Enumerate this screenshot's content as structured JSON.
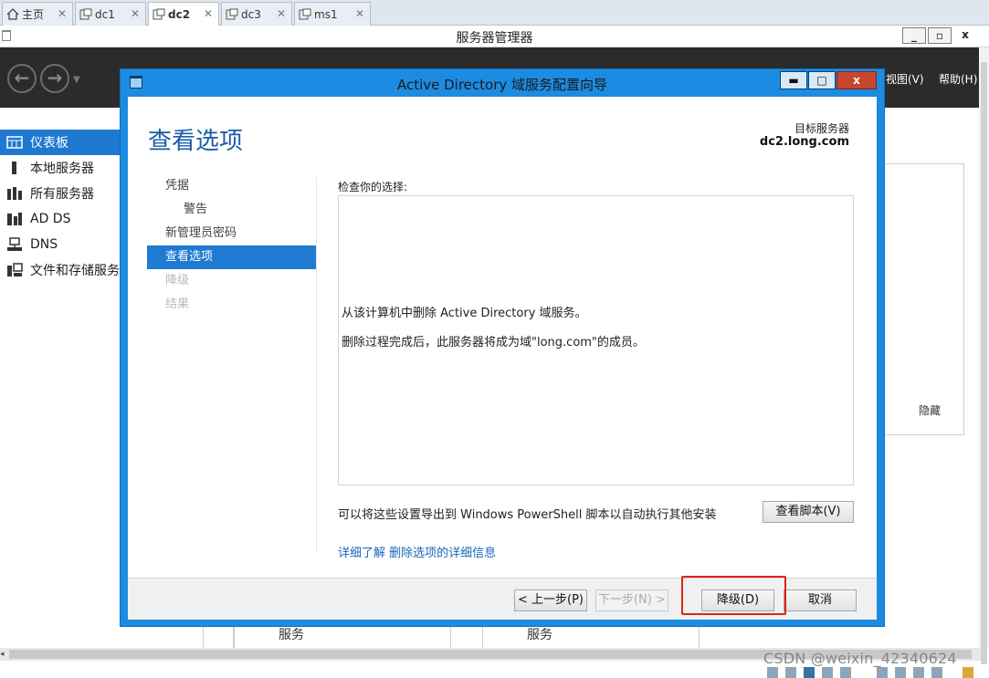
{
  "vm_tabs": [
    {
      "label": "主页",
      "close": "✕"
    },
    {
      "label": "dc1",
      "close": "✕"
    },
    {
      "label": "dc2",
      "close": "✕"
    },
    {
      "label": "dc3",
      "close": "✕"
    },
    {
      "label": "ms1",
      "close": "✕"
    }
  ],
  "server_manager": {
    "title": "服务器管理器",
    "window_controls": {
      "minimize": "_",
      "restore": "▫",
      "close": "x"
    },
    "menus": {
      "view": "视图(V)",
      "help": "帮助(H)"
    },
    "sidebar": [
      {
        "label": "仪表板",
        "icon": "dashboard-icon",
        "active": true
      },
      {
        "label": "本地服务器",
        "icon": "local-server-icon"
      },
      {
        "label": "所有服务器",
        "icon": "all-servers-icon"
      },
      {
        "label": "AD DS",
        "icon": "ad-ds-icon"
      },
      {
        "label": "DNS",
        "icon": "dns-icon"
      },
      {
        "label": "文件和存储服务",
        "icon": "file-storage-icon"
      }
    ],
    "hide_link": "隐藏",
    "bottom_tiles": [
      "服务",
      "服务"
    ]
  },
  "dialog": {
    "title": "Active Directory 域服务配置向导",
    "window_controls": {
      "minimize": "▬",
      "maximize": "□",
      "close": "x"
    },
    "page_heading": "查看选项",
    "target_server_label": "目标服务器",
    "target_server_value": "dc2.long.com",
    "steps": [
      {
        "label": "凭据",
        "state": "normal"
      },
      {
        "label": "警告",
        "state": "sub"
      },
      {
        "label": "新管理员密码",
        "state": "normal"
      },
      {
        "label": "查看选项",
        "state": "active"
      },
      {
        "label": "降级",
        "state": "disabled"
      },
      {
        "label": "结果",
        "state": "disabled"
      }
    ],
    "review_label": "检查你的选择:",
    "review_lines": [
      "从该计算机中删除 Active Directory 域服务。",
      "删除过程完成后，此服务器将成为域\"long.com\"的成员。"
    ],
    "export_text": "可以将这些设置导出到 Windows PowerShell 脚本以自动执行其他安装",
    "view_script_button": "查看脚本(V)",
    "learn_more_link": "详细了解 删除选项的详细信息",
    "buttons": {
      "previous": "< 上一步(P)",
      "next": "下一步(N) >",
      "demote": "降级(D)",
      "cancel": "取消"
    }
  },
  "watermark": "CSDN @weixin_42340624",
  "colors": {
    "dialog_frame": "#1c8ce2",
    "selection": "#1f7bd1",
    "heading": "#1a5ea8",
    "highlight": "#e0241c",
    "toolbar": "#2b2b2b"
  }
}
